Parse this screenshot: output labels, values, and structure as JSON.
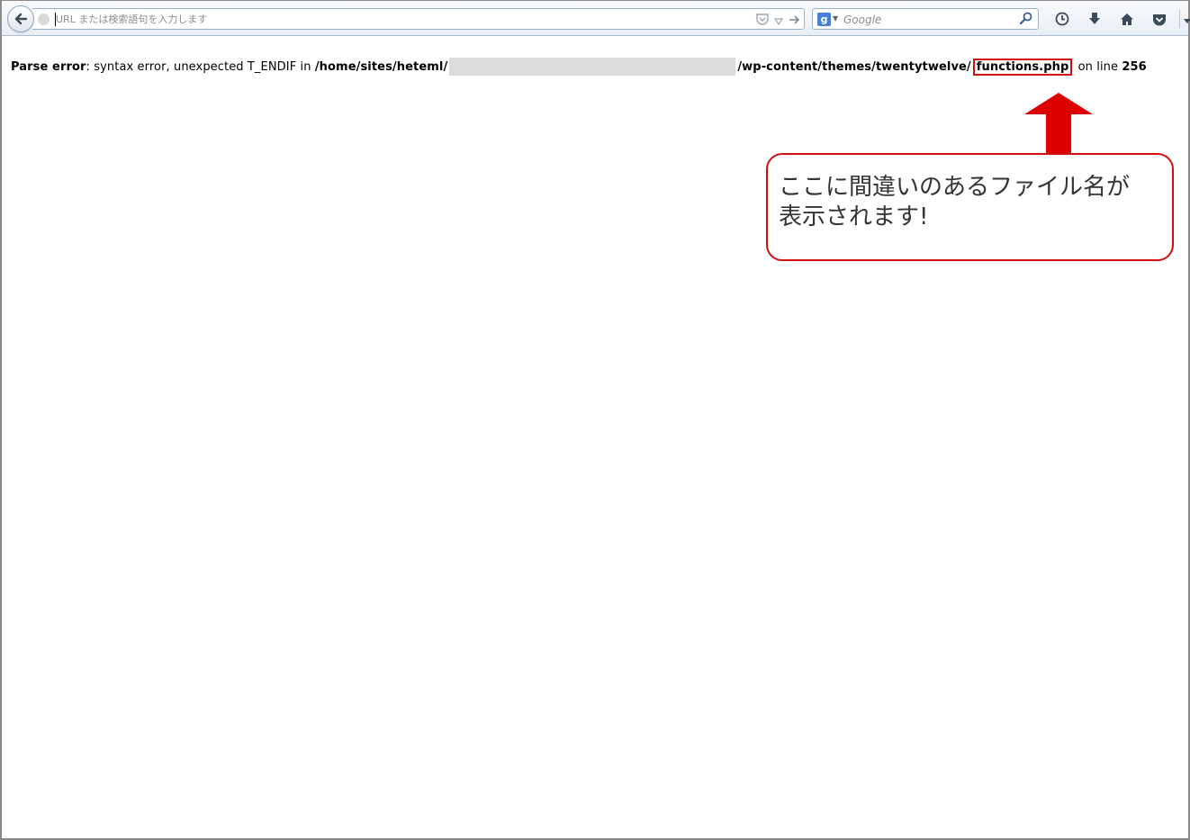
{
  "toolbar": {
    "url_placeholder": "URL または検索語句を入力します",
    "search_placeholder": "Google",
    "search_engine_letter": "g"
  },
  "error": {
    "label": "Parse error",
    "message": ": syntax error, unexpected T_ENDIF in ",
    "path_prefix": "/home/sites/heteml/",
    "path_suffix": "/wp-content/themes/twentytwelve/",
    "file": "functions.php",
    "line_text": " on line ",
    "line_number": "256"
  },
  "annotation": {
    "callout_line1": "ここに間違いのあるファイル名が",
    "callout_line2": "表示されます!"
  },
  "colors": {
    "accent_red": "#d01010",
    "arrow_red": "#dd0000",
    "redacted_gray": "#dcdcdc"
  }
}
